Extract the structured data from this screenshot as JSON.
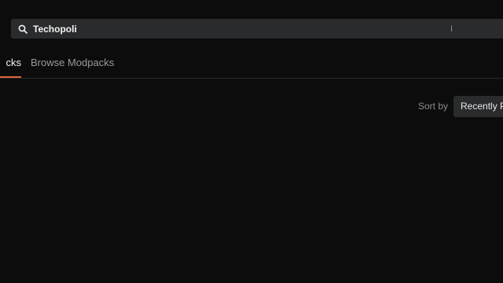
{
  "search": {
    "value": "Techopoli",
    "icon": "search-icon"
  },
  "tabs": [
    {
      "label": "My Modpacks",
      "visible_label": "cks",
      "active": true
    },
    {
      "label": "Browse Modpacks",
      "active": false
    }
  ],
  "sort": {
    "label": "Sort by",
    "selected": "Recently P"
  },
  "colors": {
    "background": "#0c0c0d",
    "search_bg": "#2a2b2d",
    "accent": "#e0623c"
  }
}
